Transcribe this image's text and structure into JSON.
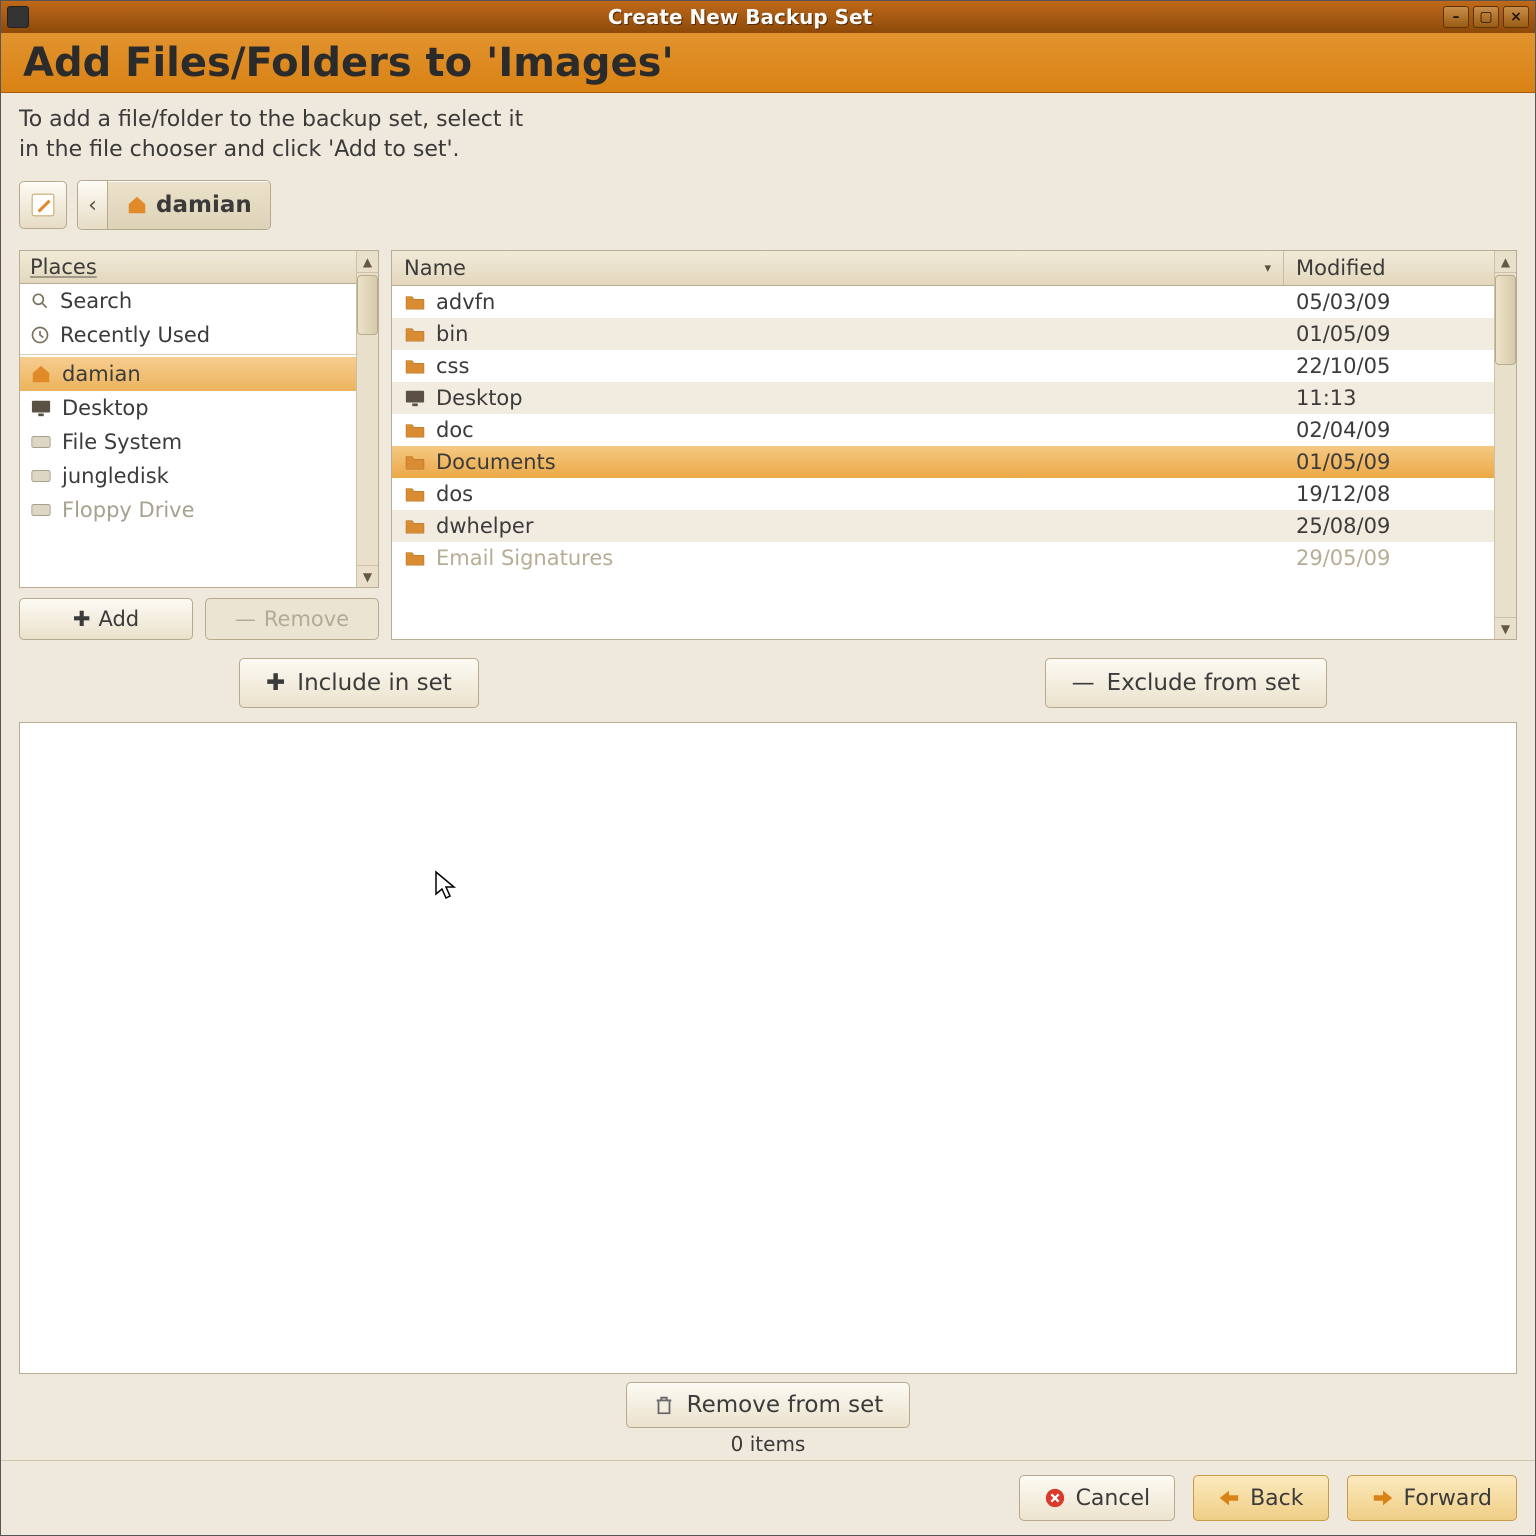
{
  "window": {
    "title": "Create New Backup Set",
    "heading": "Add Files/Folders to 'Images'",
    "instruction_l1": "To add a file/folder to the backup set, select it",
    "instruction_l2": "in the file chooser and click 'Add to set'."
  },
  "breadcrumb": {
    "current": "damian"
  },
  "places": {
    "header": "Places",
    "items": [
      {
        "label": "Search",
        "icon": "search",
        "selected": false
      },
      {
        "label": "Recently Used",
        "icon": "recent",
        "selected": false
      },
      {
        "label": "damian",
        "icon": "home",
        "selected": true
      },
      {
        "label": "Desktop",
        "icon": "desktop",
        "selected": false
      },
      {
        "label": "File System",
        "icon": "drive",
        "selected": false
      },
      {
        "label": "jungledisk",
        "icon": "drive",
        "selected": false
      },
      {
        "label": "Floppy Drive",
        "icon": "drive",
        "selected": false,
        "disabled": true
      }
    ],
    "add_label": "Add",
    "remove_label": "Remove"
  },
  "filelist": {
    "header_name": "Name",
    "header_modified": "Modified",
    "rows": [
      {
        "name": "advfn",
        "icon": "folder",
        "modified": "05/03/09"
      },
      {
        "name": "bin",
        "icon": "folder",
        "modified": "01/05/09"
      },
      {
        "name": "css",
        "icon": "folder",
        "modified": "22/10/05"
      },
      {
        "name": "Desktop",
        "icon": "desktop",
        "modified": "11:13"
      },
      {
        "name": "doc",
        "icon": "folder",
        "modified": "02/04/09"
      },
      {
        "name": "Documents",
        "icon": "folder",
        "modified": "01/05/09",
        "selected": true
      },
      {
        "name": "dos",
        "icon": "folder",
        "modified": "19/12/08"
      },
      {
        "name": "dwhelper",
        "icon": "folder",
        "modified": "25/08/09"
      },
      {
        "name": "Email Signatures",
        "icon": "folder",
        "modified": "29/05/09",
        "cut": true
      }
    ]
  },
  "actions": {
    "include": "Include in set",
    "exclude": "Exclude from set",
    "remove": "Remove from set"
  },
  "status": {
    "items": "0 items"
  },
  "footer": {
    "cancel": "Cancel",
    "back": "Back",
    "forward": "Forward"
  }
}
